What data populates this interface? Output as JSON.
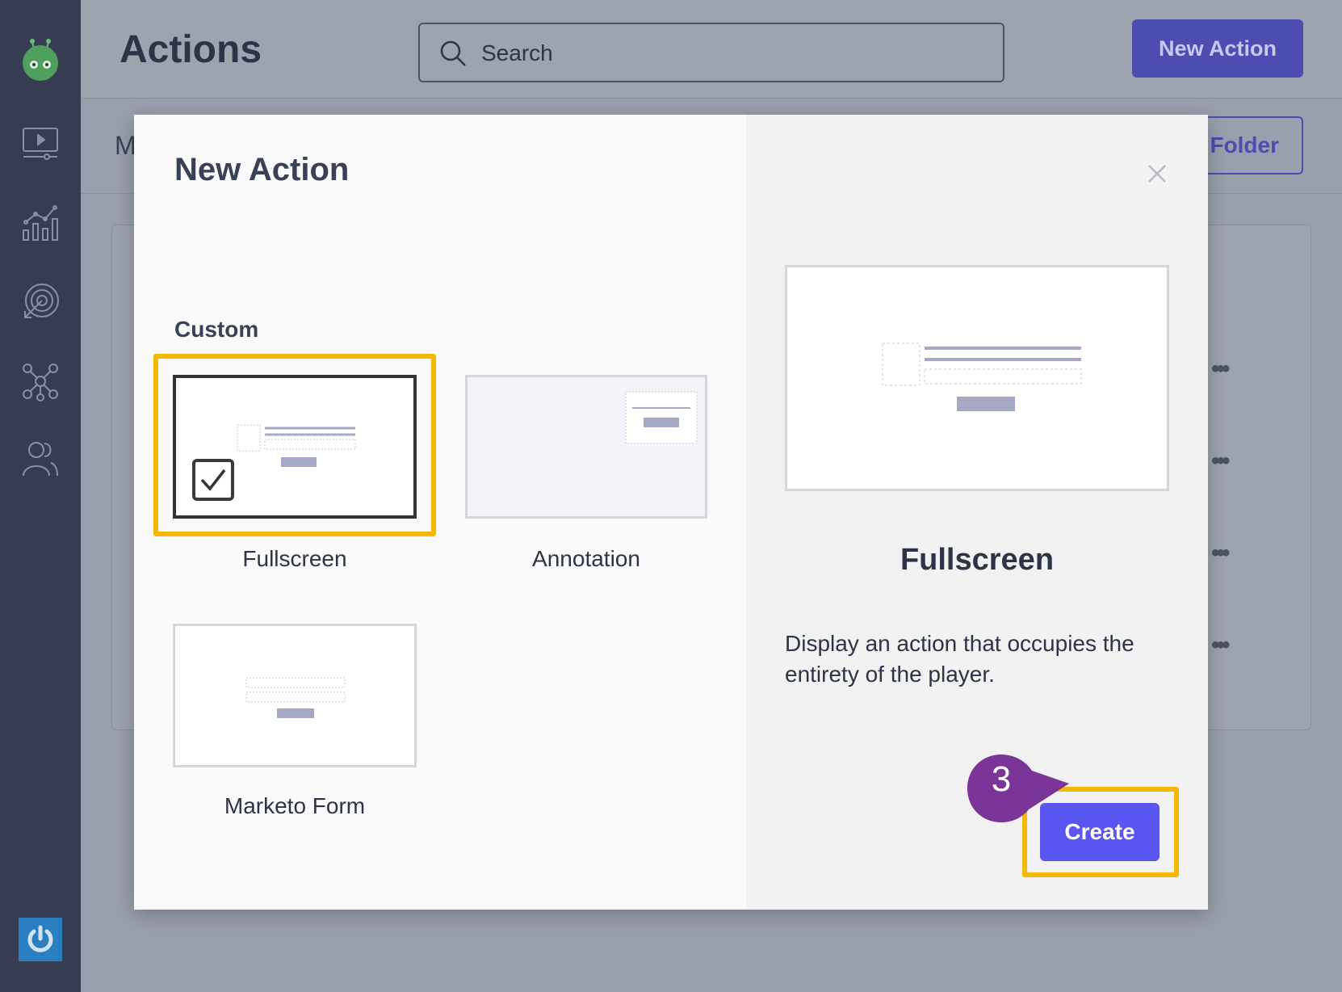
{
  "header": {
    "title": "Actions",
    "search_placeholder": "Search",
    "new_action_label": "New Action"
  },
  "background": {
    "subbar_letter": "M",
    "folder_label": "Folder",
    "row_menu_glyph": "•••"
  },
  "sidebar": {
    "icons": [
      "robot-logo-icon",
      "video-icon",
      "analytics-icon",
      "target-icon",
      "network-icon",
      "users-icon"
    ],
    "power_icon": "power-icon"
  },
  "modal": {
    "title": "New Action",
    "section_label": "Custom",
    "tiles": [
      {
        "label": "Fullscreen",
        "selected": true
      },
      {
        "label": "Annotation",
        "selected": false
      },
      {
        "label": "Marketo Form",
        "selected": false
      }
    ],
    "preview": {
      "title": "Fullscreen",
      "description": "Display an action that occupies the entirety of the player."
    },
    "create_label": "Create",
    "step_number": "3"
  },
  "colors": {
    "sidebar": "#363d52",
    "accent": "#5b55f2",
    "highlight": "#f5b800",
    "step_marker": "#7b3497"
  }
}
